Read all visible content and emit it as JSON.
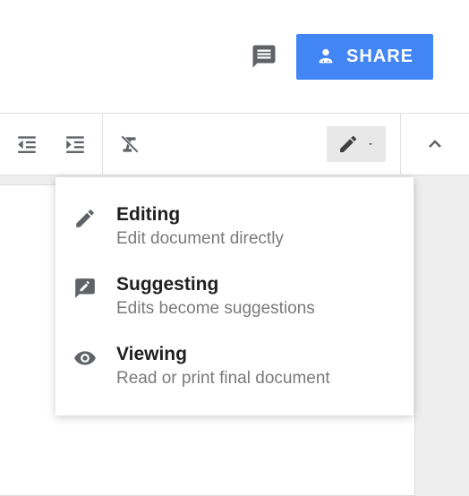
{
  "header": {
    "share_label": "SHARE"
  },
  "mode_menu": {
    "items": [
      {
        "title": "Editing",
        "desc": "Edit document directly"
      },
      {
        "title": "Suggesting",
        "desc": "Edits become suggestions"
      },
      {
        "title": "Viewing",
        "desc": "Read or print final document"
      }
    ]
  }
}
